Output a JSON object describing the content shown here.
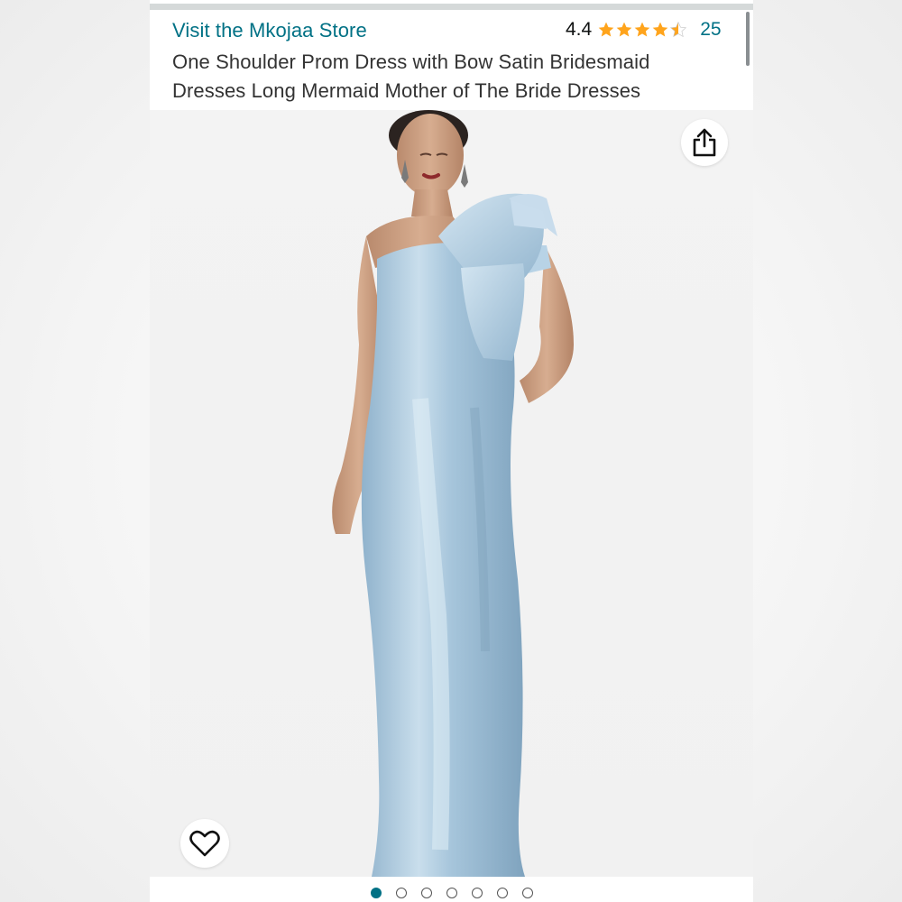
{
  "store": {
    "link_text": "Visit the Mkojaa Store"
  },
  "rating": {
    "value": "4.4",
    "stars": 4.4,
    "count": "25",
    "star_color": "#ffa41c"
  },
  "product": {
    "title": "One Shoulder Prom Dress with Bow Satin Bridesmaid Dresses Long Mermaid Mother of The Bride Dresses",
    "image_subject": "model wearing light blue one-shoulder satin mermaid gown with large bow"
  },
  "actions": {
    "share_icon": "share-icon",
    "wishlist_icon": "heart-icon"
  },
  "carousel": {
    "total": 7,
    "active": 0
  },
  "colors": {
    "link": "#007185",
    "dress": "#a9c8de",
    "active_dot": "#007185"
  }
}
